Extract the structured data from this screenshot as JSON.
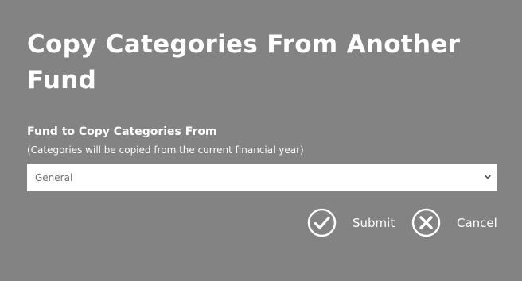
{
  "dialog": {
    "title": "Copy Categories From Another Fund"
  },
  "fund_field": {
    "label": "Fund to Copy Categories From",
    "hint": "(Categories will be copied from the current financial year)",
    "selected_value": "General",
    "chevron_icon": "chevron-down-icon"
  },
  "actions": {
    "submit_label": "Submit",
    "submit_icon": "check-circle-icon",
    "cancel_label": "Cancel",
    "cancel_icon": "x-circle-icon"
  },
  "colors": {
    "overlay_background": "#838383",
    "text": "#ffffff",
    "select_background": "#ffffff",
    "select_text": "#6f6f6f"
  }
}
